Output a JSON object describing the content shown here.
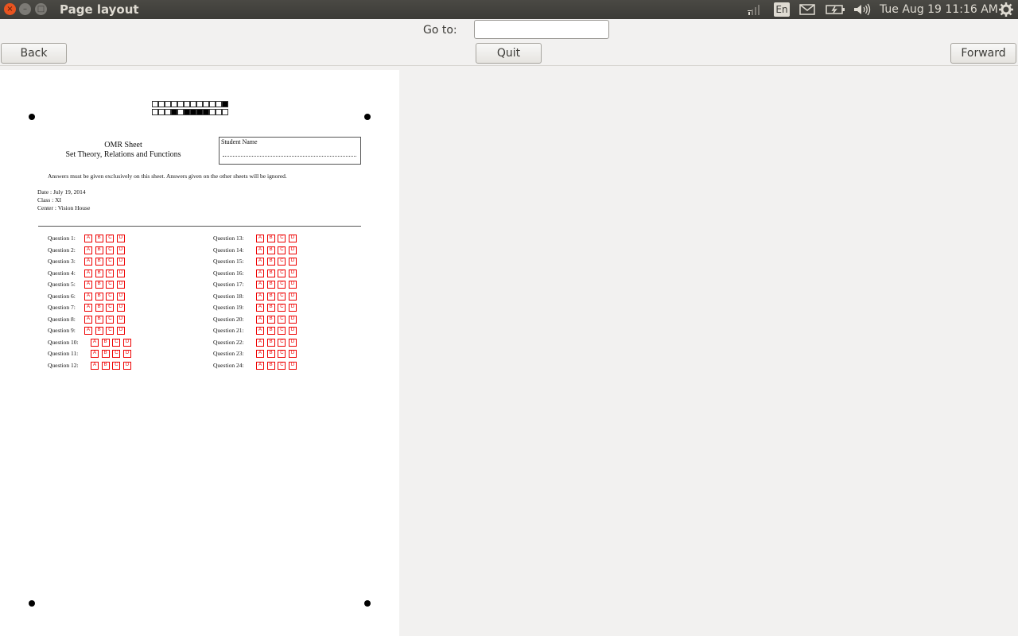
{
  "window": {
    "title": "Page layout",
    "close_glyph": "×",
    "min_glyph": "–",
    "max_glyph": "□"
  },
  "tray": {
    "language": "En",
    "clock": "Tue Aug 19 11:16 AM",
    "icons": [
      "network-icon",
      "mail-icon",
      "battery-icon",
      "volume-icon",
      "gear-icon"
    ]
  },
  "toolbar": {
    "goto_label": "Go to:",
    "goto_value": "",
    "back_label": "Back",
    "quit_label": "Quit",
    "forward_label": "Forward"
  },
  "sheet": {
    "title": "OMR Sheet",
    "subtitle": "Set Theory, Relations and Functions",
    "name_label": "Student Name",
    "instructions": "Answers must be given exclusively on this sheet. Answers given on the other sheets will be ignored.",
    "date": "Date : July 19, 2014",
    "class": "Class : XI",
    "center": "Center : Vision House",
    "code_rows": [
      [
        0,
        0,
        0,
        0,
        0,
        0,
        0,
        0,
        0,
        0,
        0,
        1
      ],
      [
        0,
        0,
        0,
        1,
        0,
        1,
        1,
        1,
        1,
        0,
        0,
        0
      ]
    ],
    "options": [
      "A",
      "B",
      "C",
      "D"
    ],
    "questions_left": [
      "Question 1:",
      "Question 2:",
      "Question 3:",
      "Question 4:",
      "Question 5:",
      "Question 6:",
      "Question 7:",
      "Question 8:",
      "Question 9:",
      "Question 10:",
      "Question 11:",
      "Question 12:"
    ],
    "questions_right": [
      "Question 13:",
      "Question 14:",
      "Question 15:",
      "Question 16:",
      "Question 17:",
      "Question 18:",
      "Question 19:",
      "Question 20:",
      "Question 21:",
      "Question 22:",
      "Question 23:",
      "Question 24:"
    ]
  },
  "colors": {
    "bubble": "#e00000",
    "topbar": "#3c3b37",
    "close_button": "#e95420"
  }
}
